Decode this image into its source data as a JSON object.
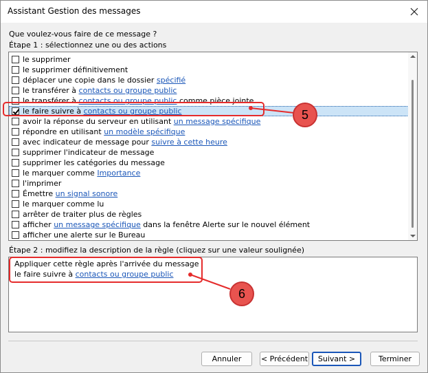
{
  "window": {
    "title": "Assistant Gestion des messages"
  },
  "question": "Que voulez-vous faire de ce message ?",
  "step1_label": "Étape 1 : sélectionnez une ou des actions",
  "actions": [
    {
      "checked": false,
      "parts": [
        {
          "t": "le supprimer"
        }
      ]
    },
    {
      "checked": false,
      "parts": [
        {
          "t": "le supprimer définitivement"
        }
      ]
    },
    {
      "checked": false,
      "parts": [
        {
          "t": "déplacer une copie dans le dossier "
        },
        {
          "t": "spécifié",
          "link": true
        }
      ]
    },
    {
      "checked": false,
      "parts": [
        {
          "t": "le transférer à "
        },
        {
          "t": "contacts ou groupe public",
          "link": true
        }
      ]
    },
    {
      "checked": false,
      "parts": [
        {
          "t": "le transférer à "
        },
        {
          "t": "contacts ou groupe public",
          "link": true
        },
        {
          "t": " comme pièce jointe"
        }
      ]
    },
    {
      "checked": true,
      "selected": true,
      "parts": [
        {
          "t": "le faire suivre à "
        },
        {
          "t": "contacts ou groupe public",
          "link": true
        }
      ]
    },
    {
      "checked": false,
      "parts": [
        {
          "t": "avoir la réponse du serveur en utilisant "
        },
        {
          "t": "un message spécifique",
          "link": true
        }
      ]
    },
    {
      "checked": false,
      "parts": [
        {
          "t": "répondre en utilisant "
        },
        {
          "t": "un modèle spécifique",
          "link": true
        }
      ]
    },
    {
      "checked": false,
      "parts": [
        {
          "t": "avec indicateur de message pour "
        },
        {
          "t": "suivre à cette heure",
          "link": true
        }
      ]
    },
    {
      "checked": false,
      "parts": [
        {
          "t": "supprimer l'indicateur de message"
        }
      ]
    },
    {
      "checked": false,
      "parts": [
        {
          "t": "supprimer les catégories du message"
        }
      ]
    },
    {
      "checked": false,
      "parts": [
        {
          "t": "le marquer comme "
        },
        {
          "t": "Importance",
          "link": true
        }
      ]
    },
    {
      "checked": false,
      "parts": [
        {
          "t": "l'imprimer"
        }
      ]
    },
    {
      "checked": false,
      "parts": [
        {
          "t": "Émettre "
        },
        {
          "t": "un signal sonore",
          "link": true
        }
      ]
    },
    {
      "checked": false,
      "parts": [
        {
          "t": "le marquer comme lu"
        }
      ]
    },
    {
      "checked": false,
      "parts": [
        {
          "t": "arrêter de traiter plus de règles"
        }
      ]
    },
    {
      "checked": false,
      "parts": [
        {
          "t": "afficher "
        },
        {
          "t": "un message spécifique",
          "link": true
        },
        {
          "t": " dans la fenêtre Alerte sur le nouvel élément"
        }
      ]
    },
    {
      "checked": false,
      "parts": [
        {
          "t": "afficher une alerte sur le Bureau"
        }
      ]
    }
  ],
  "step2_label": "Étape 2 : modifiez la description de la règle (cliquez sur une valeur soulignée)",
  "description": {
    "line1": "Appliquer cette règle après l'arrivée du message",
    "line2_prefix": "le faire suivre à ",
    "line2_link": "contacts ou groupe public"
  },
  "buttons": {
    "cancel": "Annuler",
    "previous": "< Précédent",
    "next": "Suivant >",
    "finish": "Terminer"
  },
  "annotations": {
    "badge5": "5",
    "badge6": "6",
    "color": "#e52b2b"
  }
}
